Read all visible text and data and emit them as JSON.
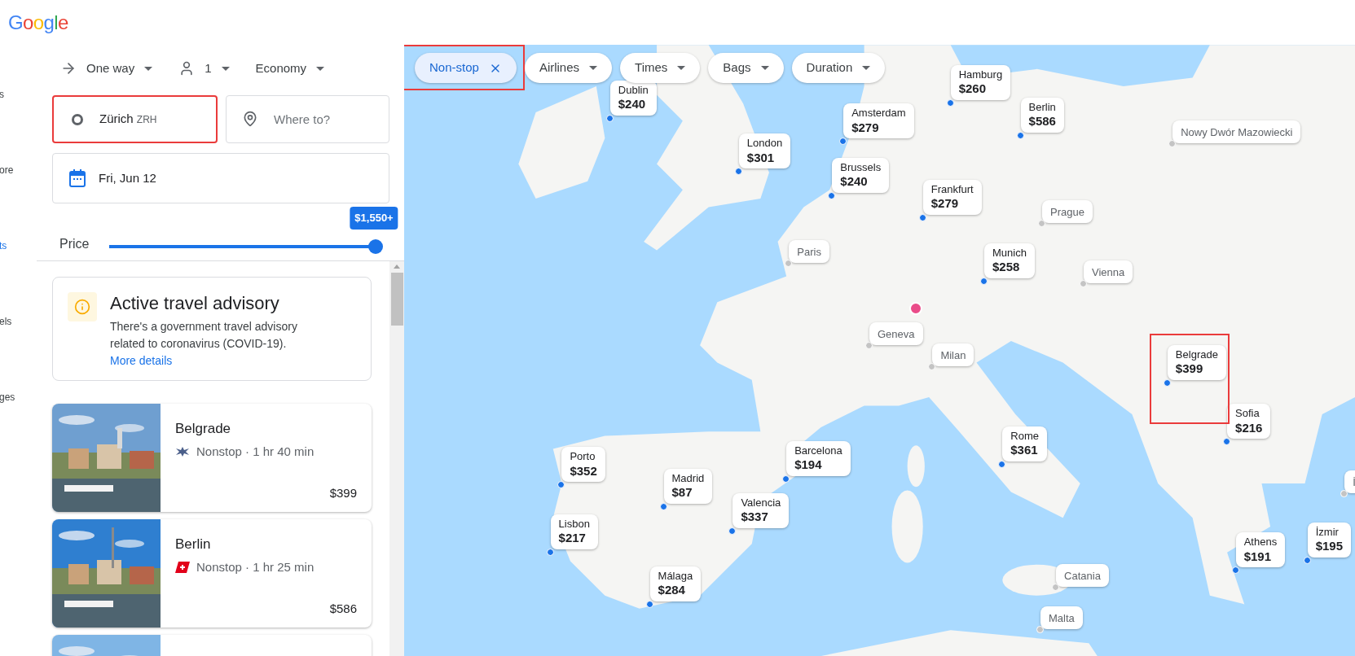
{
  "header": {
    "logo": "Google"
  },
  "nav": [
    {
      "label": "s",
      "selected": false
    },
    {
      "label": "ore",
      "selected": false
    },
    {
      "label": "ts",
      "selected": true
    },
    {
      "label": "els",
      "selected": false
    },
    {
      "label": "ges",
      "selected": false
    }
  ],
  "trip_options": [
    {
      "kind": "trip",
      "label": "One way"
    },
    {
      "kind": "passengers",
      "label": "1"
    },
    {
      "kind": "cabin",
      "label": "Economy"
    }
  ],
  "origin": {
    "value": "Zürich",
    "code": "ZRH"
  },
  "destination": {
    "placeholder": "Where to?"
  },
  "date": {
    "value": "Fri, Jun 12"
  },
  "price": {
    "label": "Price",
    "reading": "$1,550+",
    "level": 1
  },
  "advisory": {
    "title": "Active travel advisory",
    "text": "There's a government travel advisory related to coronavirus (COVID-19).",
    "link": "More details"
  },
  "results": [
    {
      "kind": "bird",
      "city": "Belgrade",
      "details": "Nonstop · 1 hr 40 min",
      "price": "$399"
    },
    {
      "kind": "cross",
      "city": "Berlin",
      "details": "Nonstop · 1 hr 25 min",
      "price": "$586"
    },
    {
      "kind": "picture"
    }
  ],
  "filters": [
    {
      "label": "Non-stop",
      "selected": true
    },
    {
      "label": "Airlines",
      "selected": false
    },
    {
      "label": "Times",
      "selected": false
    },
    {
      "label": "Bags",
      "selected": false
    },
    {
      "label": "Duration",
      "selected": false
    }
  ],
  "pins": [
    {
      "kind": "price",
      "name": "Dublin",
      "price": "$240"
    },
    {
      "kind": "price",
      "name": "Hamburg",
      "price": "$260"
    },
    {
      "kind": "price",
      "name": "Amsterdam",
      "price": "$279"
    },
    {
      "kind": "price",
      "name": "Berlin",
      "price": "$586"
    },
    {
      "kind": "price",
      "name": "London",
      "price": "$301"
    },
    {
      "kind": "price",
      "name": "Brussels",
      "price": "$240"
    },
    {
      "kind": "price",
      "name": "Frankfurt",
      "price": "$279"
    },
    {
      "kind": "place",
      "name": "Nowy Dwór Mazowiecki"
    },
    {
      "kind": "place",
      "name": "Prague"
    },
    {
      "kind": "place",
      "name": "Paris"
    },
    {
      "kind": "price",
      "name": "Munich",
      "price": "$258"
    },
    {
      "kind": "place",
      "name": "Vienna"
    },
    {
      "kind": "place",
      "name": "Geneva"
    },
    {
      "kind": "place",
      "name": "Milan"
    },
    {
      "kind": "price",
      "name": "Belgrade",
      "price": "$399"
    },
    {
      "kind": "price",
      "name": "Sofia",
      "price": "$216"
    },
    {
      "kind": "price",
      "name": "Rome",
      "price": "$361"
    },
    {
      "kind": "price",
      "name": "Barcelona",
      "price": "$194"
    },
    {
      "kind": "price",
      "name": "Porto",
      "price": "$352"
    },
    {
      "kind": "price",
      "name": "Madrid",
      "price": "$87"
    },
    {
      "kind": "price",
      "name": "Valencia",
      "price": "$337"
    },
    {
      "kind": "price",
      "name": "Lisbon",
      "price": "$217"
    },
    {
      "kind": "price",
      "name": "Málaga",
      "price": "$284"
    },
    {
      "kind": "place",
      "name": "Catania"
    },
    {
      "kind": "place",
      "name": "Malta"
    },
    {
      "kind": "price",
      "name": "Athens",
      "price": "$191"
    },
    {
      "kind": "price",
      "name": "İzmir",
      "price": "$195"
    },
    {
      "kind": "place",
      "name": "İ"
    }
  ]
}
